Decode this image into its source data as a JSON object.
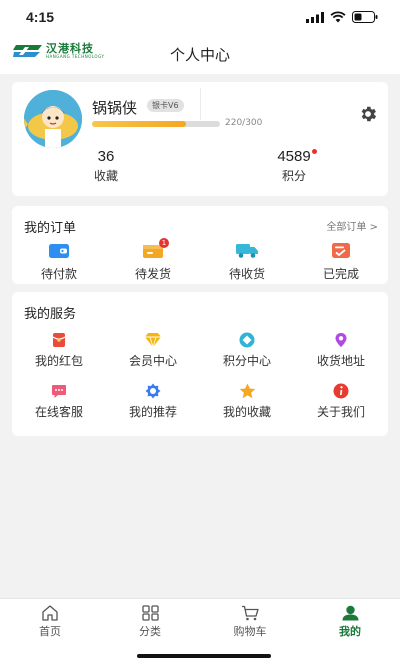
{
  "status_bar": {
    "time": "4:15"
  },
  "header": {
    "logo_cn": "汉港科技",
    "logo_en": "HANGANG TECHNOLOGY",
    "title": "个人中心"
  },
  "profile": {
    "username": "锅锅侠",
    "vip_badge": "银卡V6",
    "progress_text": "220/300",
    "progress_fraction": 0.733,
    "stats": [
      {
        "value": "36",
        "label": "收藏"
      },
      {
        "value": "4589",
        "label": "积分"
      }
    ]
  },
  "orders": {
    "title": "我的订单",
    "all_link": "全部订单 >",
    "items": [
      {
        "label": "待付款",
        "icon": "wallet-icon",
        "color": "#2f8ff0"
      },
      {
        "label": "待发货",
        "icon": "box-icon",
        "color": "#f5a623",
        "badge": "1"
      },
      {
        "label": "待收货",
        "icon": "truck-icon",
        "color": "#35b8d8"
      },
      {
        "label": "已完成",
        "icon": "completed-icon",
        "color": "#f06a4a"
      }
    ]
  },
  "services": {
    "title": "我的服务",
    "items": [
      {
        "label": "我的红包",
        "icon": "red-envelope-icon",
        "color": "#ea4b3c"
      },
      {
        "label": "会员中心",
        "icon": "diamond-icon",
        "color": "#f5b50f"
      },
      {
        "label": "积分中心",
        "icon": "points-icon",
        "color": "#2fb3d6"
      },
      {
        "label": "收货地址",
        "icon": "location-icon",
        "color": "#b14ae0"
      },
      {
        "label": "在线客服",
        "icon": "chat-icon",
        "color": "#f05a78"
      },
      {
        "label": "我的推荐",
        "icon": "recommend-icon",
        "color": "#3a7cf0"
      },
      {
        "label": "我的收藏",
        "icon": "star-icon",
        "color": "#f5a623"
      },
      {
        "label": "关于我们",
        "icon": "info-icon",
        "color": "#e83a2e"
      }
    ]
  },
  "tabbar": {
    "items": [
      {
        "label": "首页",
        "icon": "home-icon"
      },
      {
        "label": "分类",
        "icon": "category-icon"
      },
      {
        "label": "购物车",
        "icon": "cart-icon"
      },
      {
        "label": "我的",
        "icon": "user-icon",
        "active": true
      }
    ]
  },
  "colors": {
    "brand": "#1a7a3a",
    "accent": "#f5a623",
    "badge": "#e83232"
  }
}
